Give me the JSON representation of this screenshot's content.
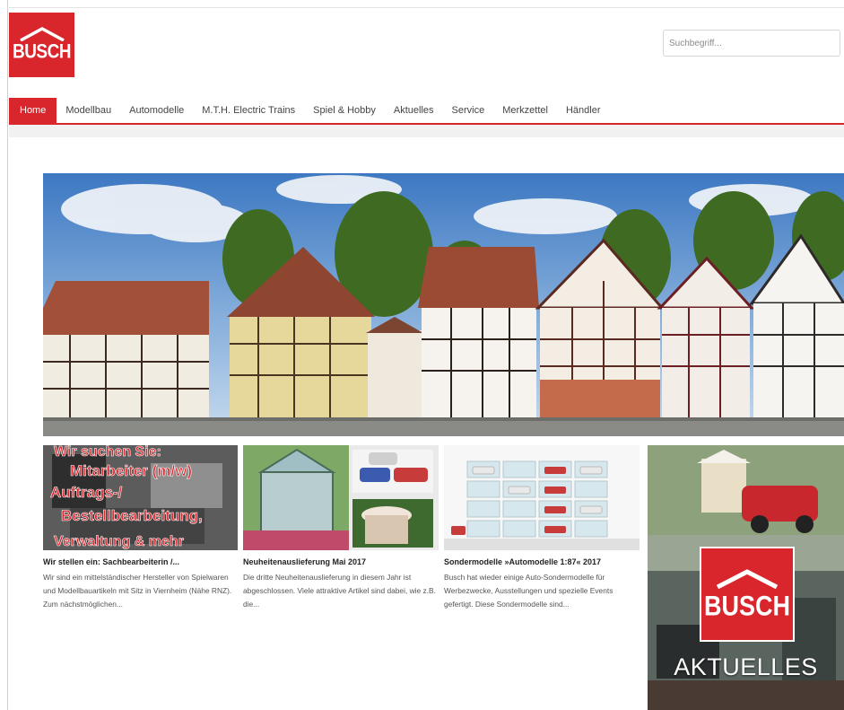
{
  "brand": {
    "logo_text": "BUSCH",
    "accent": "#d9262c"
  },
  "search": {
    "placeholder": "Suchbegriff..."
  },
  "nav": {
    "items": [
      {
        "label": "Home",
        "active": true
      },
      {
        "label": "Modellbau"
      },
      {
        "label": "Automodelle"
      },
      {
        "label": "M.T.H. Electric Trains"
      },
      {
        "label": "Spiel & Hobby"
      },
      {
        "label": "Aktuelles"
      },
      {
        "label": "Service"
      },
      {
        "label": "Merkzettel"
      },
      {
        "label": "Händler"
      }
    ]
  },
  "cards": [
    {
      "thumb_lines": [
        "Wir suchen Sie:",
        "Mitarbeiter (m/w)",
        "Auftrags-/",
        "Bestellbearbeitung,",
        "Verwaltung & mehr"
      ],
      "title": "Wir stellen ein: Sachbearbeiterin /...",
      "text": "Wir sind ein mittelständischer Hersteller von Spielwaren und Modellbauartikeln mit Sitz in Viernheim (Nähe RNZ). Zum nächstmöglichen..."
    },
    {
      "title": "Neuheitenauslieferung Mai 2017",
      "text": "Die dritte Neuheitenauslieferung in diesem Jahr ist abgeschlossen. Viele attraktive Artikel sind dabei, wie z.B. die..."
    },
    {
      "title": "Sondermodelle »Automodelle 1:87« 2017",
      "text": "Busch hat wieder einige Auto-Sondermodelle für Werbezwecke, Ausstellungen und spezielle Events gefertigt. Diese Sondermodelle sind..."
    }
  ],
  "aktuelles": {
    "logo_text": "BUSCH",
    "label": "AKTUELLES"
  }
}
